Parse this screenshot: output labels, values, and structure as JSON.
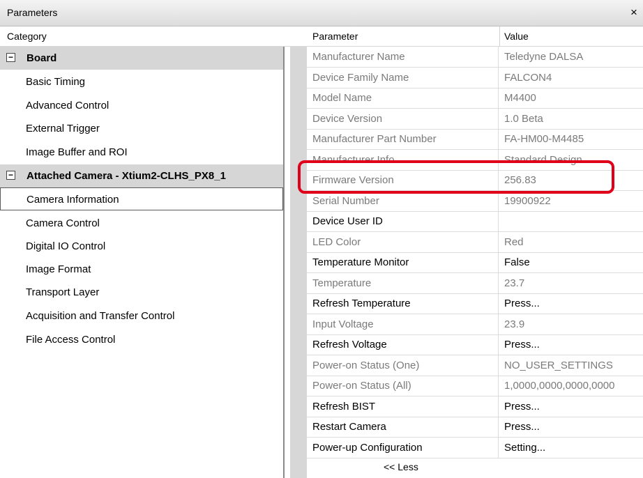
{
  "window": {
    "title": "Parameters",
    "close_glyph": "×"
  },
  "columns": {
    "category": "Category",
    "parameter": "Parameter",
    "value": "Value"
  },
  "categories": [
    {
      "label": "Board",
      "type": "group",
      "expander": "−"
    },
    {
      "label": "Basic Timing",
      "type": "child"
    },
    {
      "label": "Advanced Control",
      "type": "child"
    },
    {
      "label": "External Trigger",
      "type": "child"
    },
    {
      "label": "Image Buffer and ROI",
      "type": "child"
    },
    {
      "label": "Attached Camera - Xtium2-CLHS_PX8_1",
      "type": "group",
      "expander": "−"
    },
    {
      "label": "Camera Information",
      "type": "child",
      "selected": true
    },
    {
      "label": "Camera Control",
      "type": "child"
    },
    {
      "label": "Digital IO Control",
      "type": "child"
    },
    {
      "label": "Image Format",
      "type": "child"
    },
    {
      "label": "Transport Layer",
      "type": "child"
    },
    {
      "label": "Acquisition and Transfer Control",
      "type": "child"
    },
    {
      "label": "File Access Control",
      "type": "child"
    }
  ],
  "parameters": [
    {
      "name": "Manufacturer Name",
      "value": "Teledyne DALSA",
      "readonly": true
    },
    {
      "name": "Device Family Name",
      "value": "FALCON4",
      "readonly": true
    },
    {
      "name": "Model Name",
      "value": "M4400",
      "readonly": true
    },
    {
      "name": "Device Version",
      "value": "1.0 Beta",
      "readonly": true
    },
    {
      "name": "Manufacturer Part Number",
      "value": "FA-HM00-M4485",
      "readonly": true
    },
    {
      "name": "Manufacturer Info",
      "value": "Standard Design",
      "readonly": true
    },
    {
      "name": "Firmware Version",
      "value": "256.83",
      "readonly": true
    },
    {
      "name": "Serial Number",
      "value": "19900922",
      "readonly": true
    },
    {
      "name": "Device User ID",
      "value": "",
      "readonly": false
    },
    {
      "name": "LED Color",
      "value": "Red",
      "readonly": true
    },
    {
      "name": "Temperature Monitor",
      "value": "False",
      "readonly": false
    },
    {
      "name": "Temperature",
      "value": "23.7",
      "readonly": true
    },
    {
      "name": "Refresh Temperature",
      "value": "Press...",
      "readonly": false
    },
    {
      "name": "Input Voltage",
      "value": "23.9",
      "readonly": true
    },
    {
      "name": "Refresh Voltage",
      "value": "Press...",
      "readonly": false
    },
    {
      "name": "Power-on Status (One)",
      "value": "NO_USER_SETTINGS",
      "readonly": true
    },
    {
      "name": "Power-on Status (All)",
      "value": "1,0000,0000,0000,0000",
      "readonly": true
    },
    {
      "name": "Refresh BIST",
      "value": "Press...",
      "readonly": false
    },
    {
      "name": "Restart Camera",
      "value": "Press...",
      "readonly": false
    },
    {
      "name": "Power-up Configuration",
      "value": "Setting...",
      "readonly": false
    }
  ],
  "less_button": "<< Less",
  "colors": {
    "highlight": "#e0001a",
    "readonly_text": "#7a7a7a",
    "group_bg": "#d6d6d6"
  }
}
